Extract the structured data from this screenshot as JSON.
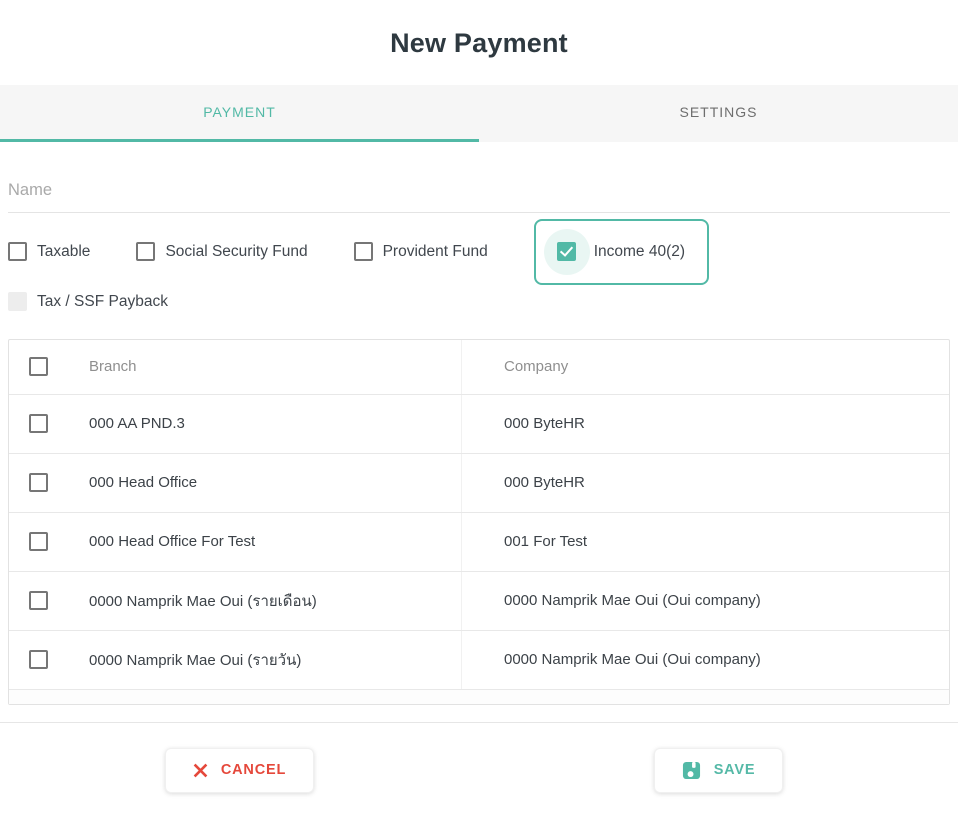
{
  "dialog": {
    "title": "New Payment",
    "tabs": [
      {
        "label": "PAYMENT",
        "active": true
      },
      {
        "label": "SETTINGS",
        "active": false
      }
    ],
    "name_field": {
      "placeholder": "Name",
      "value": ""
    },
    "options": [
      {
        "label": "Taxable",
        "checked": false
      },
      {
        "label": "Social Security Fund",
        "checked": false
      },
      {
        "label": "Provident Fund",
        "checked": false
      },
      {
        "label": "Income 40(2)",
        "checked": true,
        "highlighted": true
      }
    ],
    "payback_option": {
      "label": "Tax / SSF Payback",
      "checked": false,
      "disabled": true
    },
    "table": {
      "columns": [
        "Branch",
        "Company"
      ],
      "select_all_checked": false,
      "rows": [
        {
          "checked": false,
          "branch": "000 AA PND.3",
          "company": "000 ByteHR"
        },
        {
          "checked": false,
          "branch": "000 Head Office",
          "company": "000 ByteHR"
        },
        {
          "checked": false,
          "branch": "000 Head Office For Test",
          "company": "001 For Test"
        },
        {
          "checked": false,
          "branch": "0000 Namprik Mae Oui (รายเดือน)",
          "company": "0000 Namprik Mae Oui (Oui company)"
        },
        {
          "checked": false,
          "branch": "0000 Namprik Mae Oui (รายวัน)",
          "company": "0000 Namprik Mae Oui (Oui company)"
        }
      ]
    },
    "footer": {
      "cancel_label": "CANCEL",
      "save_label": "SAVE",
      "cancel_icon": "x-icon",
      "save_icon": "floppy-disk-icon"
    },
    "colors": {
      "accent": "#52b9a6",
      "danger": "#e5483b",
      "tab_bar_bg": "#f6f6f6"
    }
  }
}
